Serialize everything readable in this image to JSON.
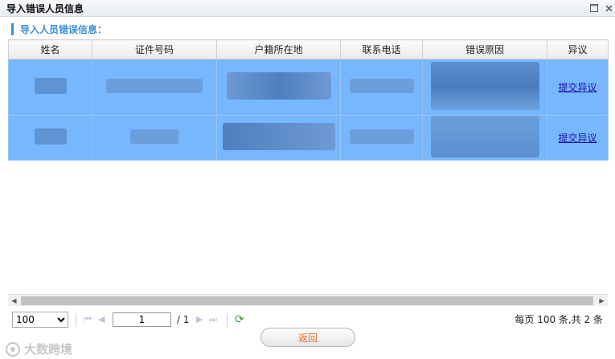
{
  "window": {
    "title": "导入错误人员信息",
    "max_icon": "maximize-icon",
    "close_icon": "close-icon"
  },
  "section": {
    "title": "导入人员错误信息："
  },
  "table": {
    "columns": [
      "姓名",
      "证件号码",
      "户籍所在地",
      "联系电话",
      "错误原因",
      "异议"
    ],
    "rows": [
      {
        "objection_link": "提交异议"
      },
      {
        "objection_link": "提交异议"
      }
    ]
  },
  "pager": {
    "page_size": "100",
    "page_size_options": [
      "100"
    ],
    "current_page": "1",
    "total_pages": "/ 1",
    "info": "每页 100 条,共 2 条"
  },
  "actions": {
    "return_label": "返回"
  },
  "watermark": {
    "text": "大数跨境"
  },
  "colors": {
    "accent": "#3d8fd3",
    "selected_row": "#77b7ff",
    "return_text": "#e0692a",
    "link": "#1a0dab"
  }
}
